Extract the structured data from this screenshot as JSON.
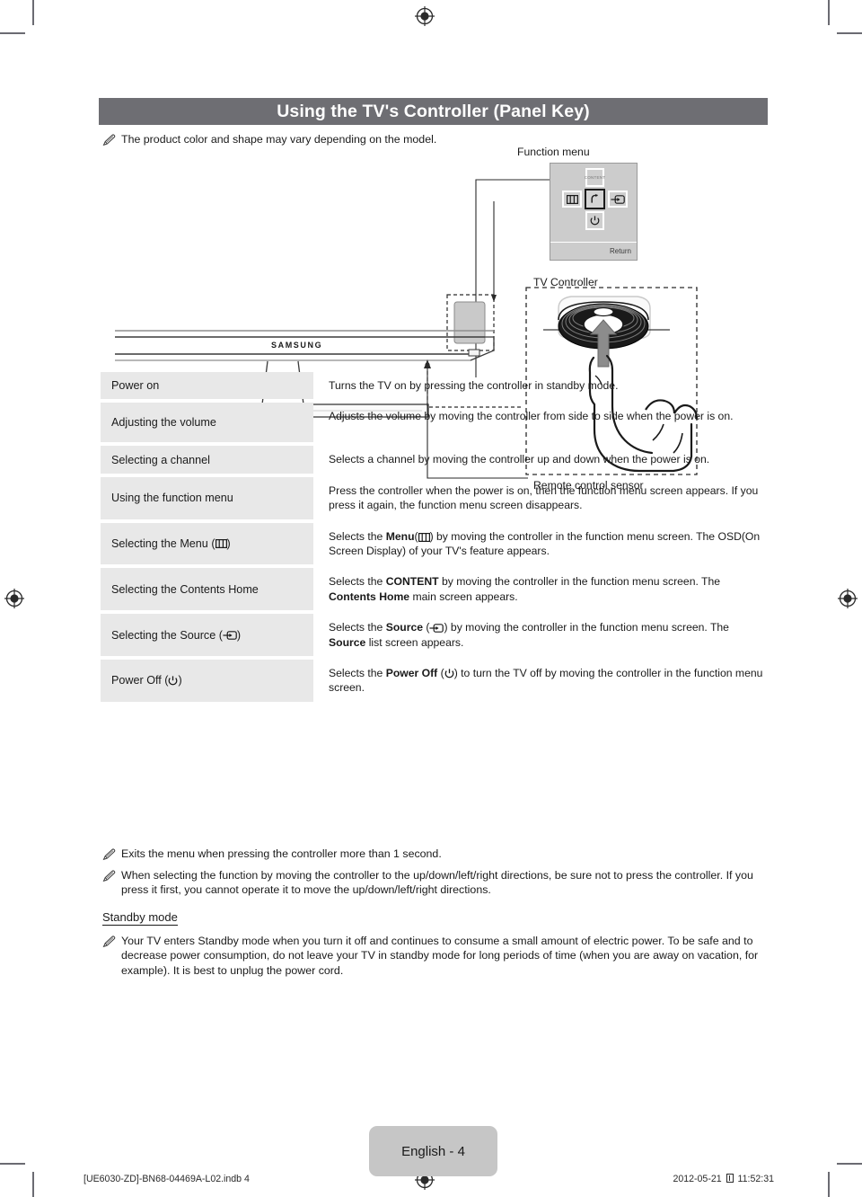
{
  "document": {
    "title": "Using the TV's Controller (Panel Key)",
    "intro_note": "The product color and shape may vary depending on the model."
  },
  "diagram": {
    "function_menu_label": "Function menu",
    "tv_controller_label": "TV Controller",
    "remote_sensor_label": "Remote control sensor",
    "brand": "SAMSUNG",
    "function_menu": {
      "up_key_label": "CONTENT",
      "left_key_icon": "menu-icon",
      "center_key_icon": "return-arrow-icon",
      "right_key_icon": "source-icon",
      "down_key_icon": "power-icon",
      "return_label": "Return"
    }
  },
  "function_table": {
    "rows": [
      {
        "label": "Power on",
        "label_icon": "",
        "desc_html": "Turns the TV on by pressing the controller in standby mode.",
        "height": "h1"
      },
      {
        "label": "Adjusting the volume",
        "label_icon": "",
        "desc_html": "Adjusts the volume by moving the controller from side to side when the power is on.",
        "height": "h2"
      },
      {
        "label": "Selecting a channel",
        "label_icon": "",
        "desc_html": "Selects a channel by moving the controller up and down when the power is on.",
        "height": "h1"
      },
      {
        "label": "Using the function menu",
        "label_icon": "",
        "desc_html": "Press the controller when the power is on, then the function menu screen appears. If you press it again, the function menu screen disappears.",
        "height": "h2"
      },
      {
        "label": "Selecting the Menu (",
        "label_icon": "menu-icon",
        "label_suffix": ")",
        "desc_html": "Selects the <b>Menu</b>(<i class=\"menu-ico\"></i>) by moving the controller in the function menu screen. The OSD(On Screen Display) of your TV's feature appears.",
        "height": "h2"
      },
      {
        "label": "Selecting the Contents Home",
        "label_icon": "",
        "desc_html": "Selects the <b>CONTENT</b> by moving the controller in the function menu screen. The <b>Contents Home</b> main screen appears.",
        "height": "h2"
      },
      {
        "label": "Selecting the Source (",
        "label_icon": "source-icon",
        "label_suffix": ")",
        "desc_html": "Selects the <b>Source</b> (<i class=\"source-ico\"></i>) by moving the controller in the function menu screen. The <b>Source</b> list screen appears.",
        "height": "h2"
      },
      {
        "label": "Power Off (",
        "label_icon": "power-icon",
        "label_suffix": ")",
        "desc_html": "Selects the <b>Power Off</b> (<i class=\"power-ico\"></i>) to turn the TV off by moving the controller in the function menu screen.",
        "height": "h2"
      }
    ]
  },
  "notes": {
    "items": [
      "Exits the menu when pressing the controller more than 1 second.",
      "When selecting the function by moving the controller to the up/down/left/right directions, be sure not to press the controller. If you press it first, you cannot operate it to move the up/down/left/right directions."
    ],
    "standby_heading": "Standby mode",
    "standby_note": "Your TV enters Standby mode when you turn it off and continues to consume a small amount of electric power. To be safe and to decrease power consumption, do not leave your TV in standby mode for long periods of time (when you are away on vacation, for example). It is best to unplug the power cord."
  },
  "footer": {
    "page_badge": "English - 4",
    "file_reference": "[UE6030-ZD]-BN68-04469A-L02.indb   4",
    "timestamp_date": "2012-05-21",
    "timestamp_time": "11:52:31"
  },
  "colors": {
    "title_bar": "#6e6e73",
    "label_cell": "#e8e8e8",
    "page_badge": "#c6c6c6",
    "crop_mark": "#6b6b72"
  }
}
